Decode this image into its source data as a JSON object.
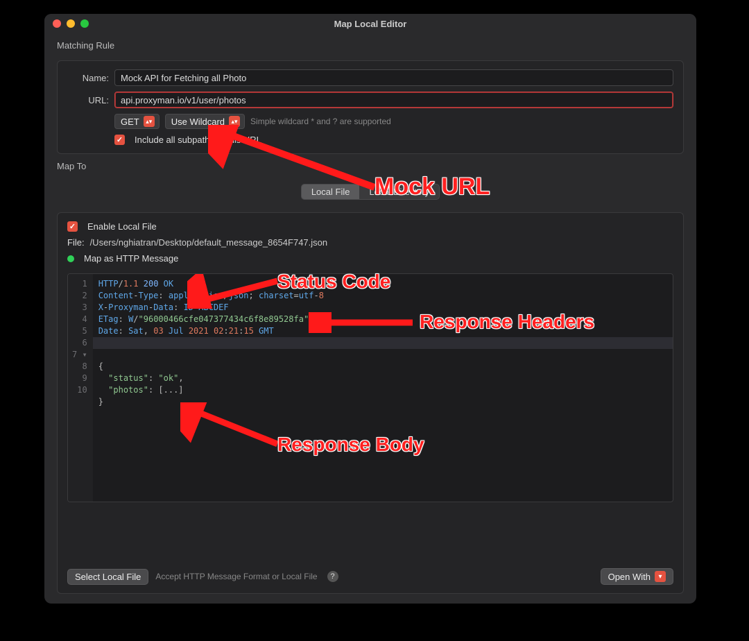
{
  "window": {
    "title": "Map Local Editor"
  },
  "matching": {
    "section_label": "Matching Rule",
    "name_label": "Name:",
    "name_value": "Mock API for Fetching all Photo",
    "url_label": "URL:",
    "url_value": "api.proxyman.io/v1/user/photos",
    "method": "GET",
    "wildcard_mode": "Use Wildcard",
    "wildcard_hint": "Simple wildcard * and ? are supported",
    "include_subpaths_label": "Include all subpaths of this URL"
  },
  "mapto": {
    "section_label": "Map To",
    "tab_local_file": "Local File",
    "tab_local_dir": "Local Directory",
    "enable_label": "Enable Local File",
    "file_label": "File:",
    "file_path": "/Users/nghiatran/Desktop/default_message_8654F747.json",
    "map_as_label": "Map as HTTP Message"
  },
  "editor": {
    "lines": [
      "HTTP/1.1 200 OK",
      "Content-Type: application/json; charset=utf-8",
      "X-Proxyman-Data: ID-ABCDEF",
      "ETag: W/\"96000466cfe047377434c6f8e89528fa\"",
      "Date: Sat, 03 Jul 2021 02:21:15 GMT",
      "",
      "{",
      "  \"status\": \"ok\",",
      "  \"photos\": [...]",
      "}"
    ]
  },
  "footer": {
    "select_file": "Select Local File",
    "accept_hint": "Accept HTTP Message Format or Local File",
    "open_with": "Open With"
  },
  "annotations": {
    "mock_url": "Mock URL",
    "status_code": "Status Code",
    "response_headers": "Response Headers",
    "response_body": "Response Body"
  }
}
